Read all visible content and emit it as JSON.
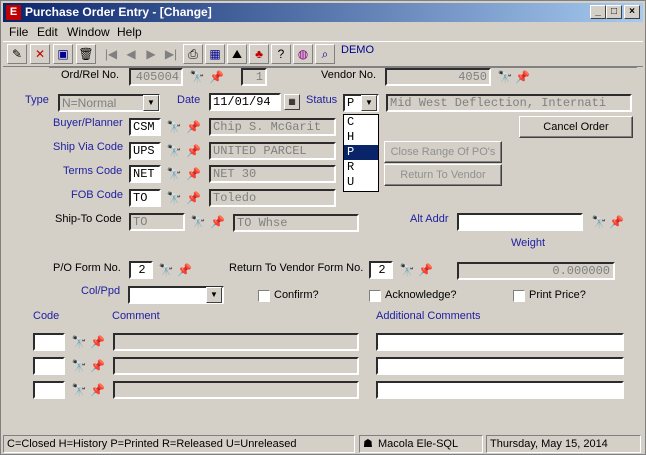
{
  "window": {
    "title": "Purchase Order Entry - [Change]",
    "app_icon": "E"
  },
  "menu": [
    "File",
    "Edit",
    "Window",
    "Help"
  ],
  "toolbar": {
    "demo": "DEMO"
  },
  "header": {
    "ord_rel_label": "Ord/Rel No.",
    "ord_no": "405004",
    "rel_no": "1",
    "vendor_label": "Vendor No.",
    "vendor_no": "4050"
  },
  "form": {
    "type_label": "Type",
    "type_value": "N=Normal",
    "date_label": "Date",
    "date_value": "11/01/94",
    "status_label": "Status",
    "status_value": "P",
    "status_options": [
      "C",
      "H",
      "P",
      "R",
      "U"
    ],
    "vendor_name": "Mid West Deflection, Internati",
    "buyer_label": "Buyer/Planner",
    "buyer_code": "CSM",
    "buyer_name": "Chip S. McGarit",
    "shipvia_label": "Ship Via Code",
    "shipvia_code": "UPS",
    "shipvia_name": "UNITED PARCEL",
    "terms_label": "Terms Code",
    "terms_code": "NET",
    "terms_name": "NET 30",
    "fob_label": "FOB Code",
    "fob_code": "TO",
    "fob_name": "Toledo",
    "shipto_label": "Ship-To Code",
    "shipto_code": "TO",
    "shipto_name": "TO Whse",
    "altaddr_label": "Alt Addr",
    "altaddr_value": "",
    "weight_label": "Weight",
    "weight_value": "0.000000",
    "poform_label": "P/O Form No.",
    "poform_value": "2",
    "rtvform_label": "Return To Vendor Form No.",
    "rtvform_value": "2",
    "colppd_label": "Col/Ppd",
    "colppd_value": "",
    "confirm_label": "Confirm?",
    "acknowledge_label": "Acknowledge?",
    "printprice_label": "Print Price?"
  },
  "buttons": {
    "cancel_order": "Cancel Order",
    "close_range": "Close Range Of PO's",
    "return_vendor": "Return To Vendor"
  },
  "comments": {
    "code_label": "Code",
    "comment_label": "Comment",
    "additional_label": "Additional Comments",
    "rows": [
      {
        "code": "",
        "comment": "",
        "additional": ""
      },
      {
        "code": "",
        "comment": "",
        "additional": ""
      },
      {
        "code": "",
        "comment": "",
        "additional": ""
      }
    ]
  },
  "statusbar": {
    "legend": "C=Closed H=History P=Printed R=Released U=Unreleased",
    "server": "Macola Ele-SQL",
    "date": "Thursday, May 15, 2014"
  }
}
